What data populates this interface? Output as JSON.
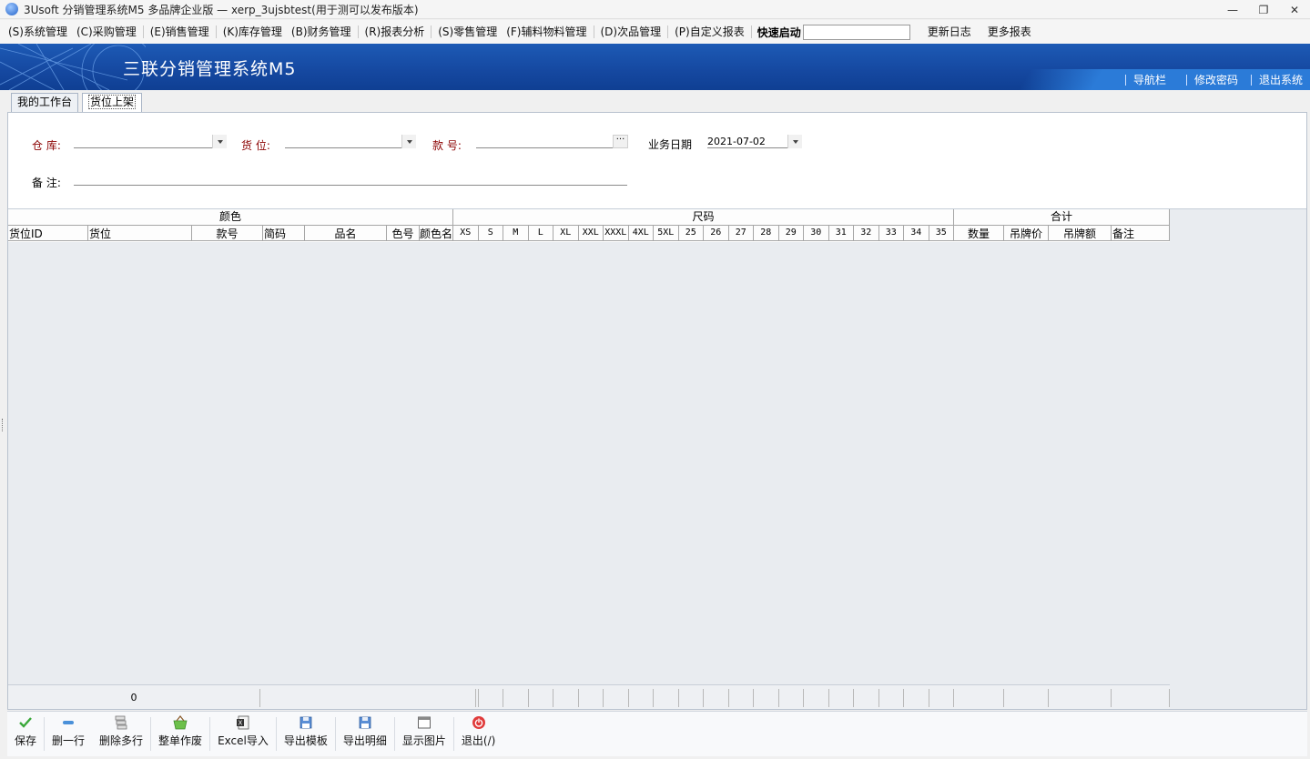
{
  "window": {
    "title": "3Usoft 分销管理系统M5 多品牌企业版 — xerp_3ujsbtest(用于测可以发布版本)",
    "minimize": "—",
    "restore": "❐",
    "close": "✕"
  },
  "menu": {
    "items": [
      "(S)系统管理",
      "(C)采购管理",
      "(E)销售管理",
      "(K)库存管理",
      "(B)财务管理",
      "(R)报表分析",
      "(S)零售管理",
      "(F)辅料物料管理",
      "(D)次品管理",
      "(P)自定义报表"
    ],
    "quick_label": "快速启动",
    "quick_value": "",
    "update_log": "更新日志",
    "more_reports": "更多报表"
  },
  "banner": {
    "title": "三联分销管理系统M5",
    "links": [
      "导航栏",
      "修改密码",
      "退出系统"
    ],
    "color": "#1548a0"
  },
  "tabs": [
    "我的工作台",
    "货位上架"
  ],
  "form": {
    "warehouse_label": "仓    库:",
    "warehouse_value": "",
    "location_label": "货    位:",
    "location_value": "",
    "style_label": "款    号:",
    "style_value": "",
    "date_label": "业务日期",
    "date_value": "2021-07-02",
    "remark_label": "备    注:",
    "remark_value": "",
    "ellipsis": "···"
  },
  "grid": {
    "group_color": "颜色",
    "group_size": "尺码",
    "group_total": "合计",
    "columns": {
      "loc_id": "货位ID",
      "loc": "货位",
      "style_no": "款号",
      "short_code": "简码",
      "product_name": "品名",
      "color_no": "色号",
      "color_name": "颜色名",
      "qty": "数量",
      "tag_price": "吊牌价",
      "tag_amount": "吊牌额",
      "remark": "备注"
    },
    "sizes": [
      "XS",
      "S",
      "M",
      "L",
      "XL",
      "XXL",
      "XXXL",
      "4XL",
      "5XL",
      "25",
      "26",
      "27",
      "28",
      "29",
      "30",
      "31",
      "32",
      "33",
      "34",
      "35"
    ],
    "footer_count": "0"
  },
  "toolbar": {
    "save": "保存",
    "delete_row": "删一行",
    "delete_rows": "删除多行",
    "void_order": "整单作废",
    "excel_import": "Excel导入",
    "export_template": "导出模板",
    "export_detail": "导出明细",
    "show_image": "显示图片",
    "exit": "退出(/)"
  },
  "icons": {
    "save": "check-icon",
    "delete_row": "minus-icon",
    "delete_rows": "stack-icon",
    "void_order": "basket-icon",
    "excel_import": "excel-icon",
    "export_template": "floppy-icon",
    "export_detail": "floppy-icon",
    "show_image": "window-icon",
    "exit": "power-icon"
  }
}
